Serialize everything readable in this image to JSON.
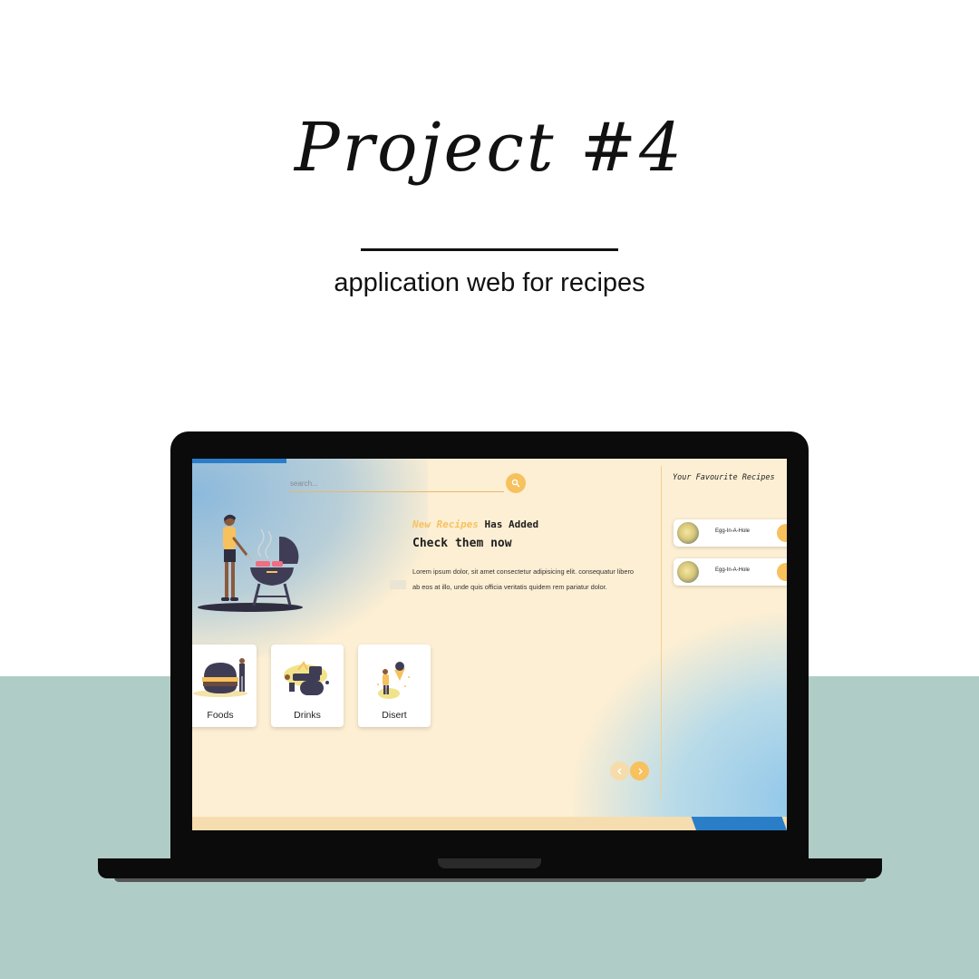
{
  "heading": {
    "title": "Project #4",
    "subtitle": "application web for recipes"
  },
  "app": {
    "search": {
      "placeholder": "search...",
      "value": ""
    },
    "hero": {
      "headline_accent": "New Recipes",
      "headline_rest": " Has Added",
      "headline_line2": "Check them now",
      "body": "Lorem ipsum dolor, sit amet consectetur adipisicing elit. consequatur libero ab eos at illo, unde quis officia veritatis quidem rem pariatur dolor."
    },
    "categories": [
      {
        "label": "Foods"
      },
      {
        "label": "Drinks"
      },
      {
        "label": "Disert"
      }
    ],
    "favourites": {
      "title": "Your Favourite Recipes",
      "items": [
        {
          "name": "Egg-In-A-Hole"
        },
        {
          "name": "Egg-In-A-Hole"
        }
      ]
    },
    "colors": {
      "accent": "#f7c15e",
      "background": "#fdefd3",
      "blue": "#2a7ec8"
    }
  }
}
